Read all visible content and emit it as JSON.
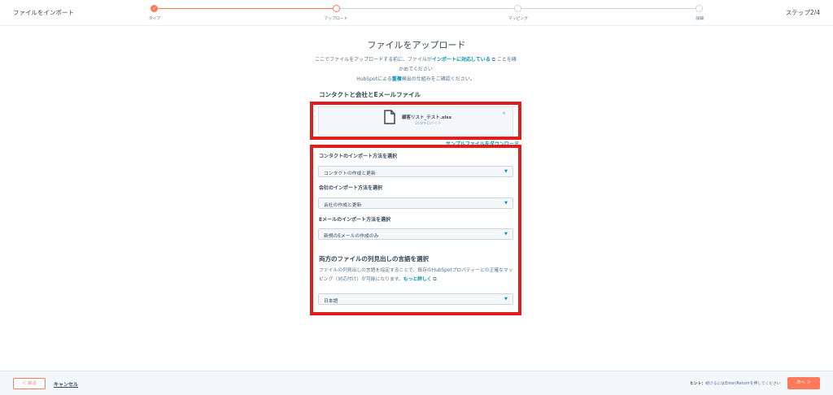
{
  "header": {
    "title": "ファイルをインポート",
    "step_count": "ステップ2/4",
    "steps": [
      {
        "label": "タイプ",
        "state": "done"
      },
      {
        "label": "アップロード",
        "state": "current"
      },
      {
        "label": "マッピング",
        "state": "todo"
      },
      {
        "label": "詳細",
        "state": "todo"
      }
    ]
  },
  "main": {
    "title": "ファイルをアップロード",
    "desc_1": "ここでファイルをアップロードする前に、ファイルが",
    "desc_link": "インポートに対応している",
    "desc_2": "ことを確かめてください",
    "desc_3_pre": "HubSpotによる",
    "desc_3_link": "重複",
    "desc_3_post": "検出の仕組みをご確認ください。"
  },
  "upload": {
    "section_title": "コンタクトと会社とEメールファイル",
    "file_name": "顧客リスト_テスト.xlsx",
    "file_size": "10.8キロバイト",
    "remove": "×",
    "sample_link": "サンプルファイルをダウンロード"
  },
  "options": {
    "contact_label": "コンタクトのインポート方法を選択",
    "contact_value": "コンタクトの作成と更新",
    "company_label": "会社のインポート方法を選択",
    "company_value": "会社の作成と更新",
    "email_label": "Eメールのインポート方法を選択",
    "email_value": "新規のEメールの作成のみ",
    "caret": "▼"
  },
  "language": {
    "title": "両方のファイルの列見出しの言語を選択",
    "desc": "ファイルの列見出しの言語を指定することで、既存のHubSpotプロパティーとの正確なマッピング（対応付け）が可能になります。",
    "learn_more": "もっと詳しく",
    "value": "日本語"
  },
  "footer": {
    "back_label": "＜ 戻る",
    "cancel_label": "キャンセル",
    "hint_label": "ヒント：",
    "hint_text": "続けるにはEnter/Returnを押してください",
    "next_label": "次へ ＞"
  },
  "colors": {
    "accent": "#ff7a59",
    "link": "#0091ae",
    "highlight": "#e01e1e"
  }
}
